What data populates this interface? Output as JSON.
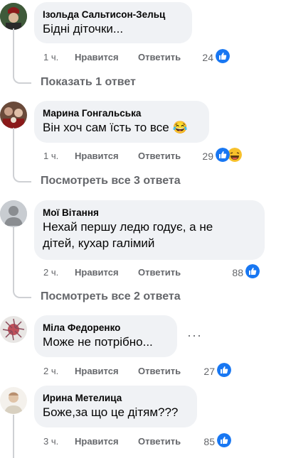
{
  "comments": [
    {
      "author": "Ізольда Сальтисон-Зельц",
      "text": "Бідні діточки...",
      "time": "1 ч.",
      "like": "Нравится",
      "reply": "Ответить",
      "count": "24",
      "reactions": [
        "like-icon"
      ]
    },
    {
      "author": "Марина Гонгальська",
      "text": "Він хоч сам їсть то все 😂",
      "time": "1 ч.",
      "like": "Нравится",
      "reply": "Ответить",
      "count": "29",
      "reactions": [
        "like-icon",
        "laughing-emoji-icon"
      ]
    },
    {
      "author": "Мої Вітання",
      "text_line1": "Нехай першу ледю годує, а не",
      "text_line2": "дітей, кухар галімий",
      "time": "2 ч.",
      "like": "Нравится",
      "reply": "Ответить",
      "count": "88",
      "reactions": [
        "like-icon"
      ]
    },
    {
      "author": "Міла Федоренко",
      "text": "Може не потрібно...",
      "time": "2 ч.",
      "like": "Нравится",
      "reply": "Ответить",
      "count": "27",
      "reactions": [
        "like-icon"
      ],
      "more": "···"
    },
    {
      "author": "Ирина Метелица",
      "text": "Боже,за що це дітям???",
      "time": "3 ч.",
      "like": "Нравится",
      "reply": "Ответить",
      "count": "85",
      "reactions": [
        "like-icon"
      ]
    }
  ],
  "replies_links": [
    "Показать 1 ответ",
    "Посмотреть все 3 ответа",
    "Посмотреть все 2 ответа"
  ],
  "colors": {
    "like_blue": "#1877f2",
    "meta_grey": "#65676b",
    "bubble": "#f0f2f5"
  }
}
